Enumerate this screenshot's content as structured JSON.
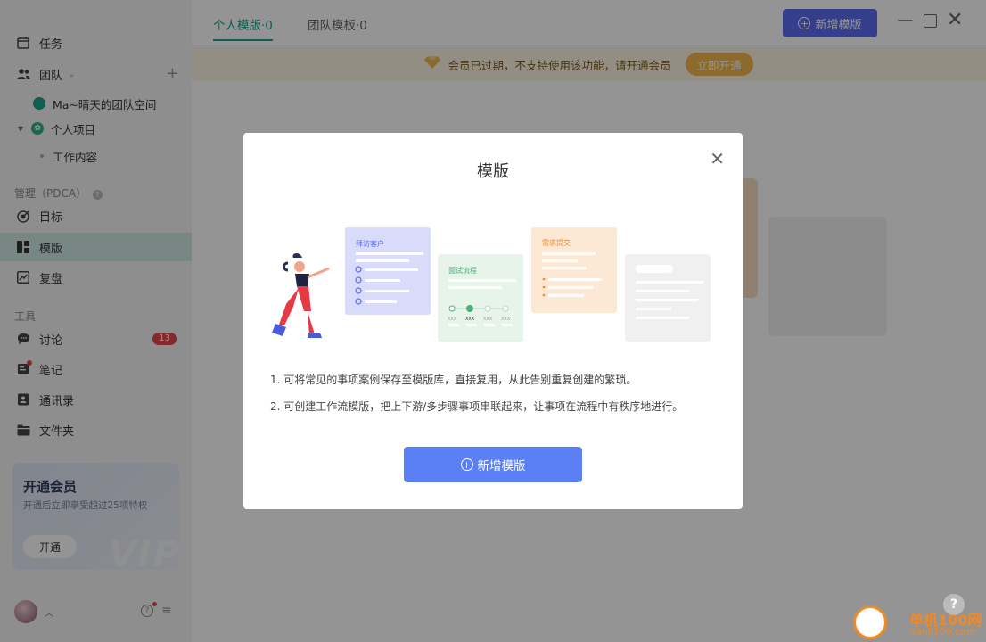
{
  "sidebar": {
    "tasks_label": "任务",
    "team_label": "团队",
    "team_space_label": "Ma~晴天的团队空间",
    "personal_project_label": "个人项目",
    "work_content_label": "工作内容",
    "manage_section_label": "管理（PDCA）",
    "goals_label": "目标",
    "templates_label": "模版",
    "review_label": "复盘",
    "tools_section_label": "工具",
    "discussion_label": "讨论",
    "discussion_badge": "13",
    "notes_label": "笔记",
    "contacts_label": "通讯录",
    "folder_label": "文件夹",
    "vip_card": {
      "title": "开通会员",
      "subtitle": "开通后立即享受超过25项特权",
      "button_label": "开通",
      "watermark": "VIP"
    }
  },
  "topbar": {
    "tabs": [
      {
        "label": "个人模版·0"
      },
      {
        "label": "团队模板·0"
      }
    ],
    "add_button_label": "新增模版"
  },
  "notice": {
    "text": "会员已过期，不支持使用该功能，请开通会员",
    "button_label": "立即开通"
  },
  "modal": {
    "title": "模版",
    "illustration": {
      "card1_title": "拜访客户",
      "card2_title": "面试流程",
      "card3_title": "需求提交",
      "card2_steps": [
        "XXX",
        "XXX",
        "XXX",
        "XXX"
      ]
    },
    "desc1": "1. 可将常见的事项案例保存至模版库，直接复用，从此告别重复创建的繁琐。",
    "desc2": "2. 可创建工作流模版，把上下游/多步骤事项串联起来，让事项在流程中有秩序地进行。",
    "button_label": "新增模版"
  },
  "watermark": {
    "line1": "单机100网",
    "line2": "danji100.com"
  },
  "colors": {
    "accent_green": "#1aa38c",
    "primary_blue": "#5b6cf0",
    "modal_button_blue": "#5b7ff5",
    "badge_red": "#e5484d",
    "notice_orange": "#f2b54c"
  }
}
